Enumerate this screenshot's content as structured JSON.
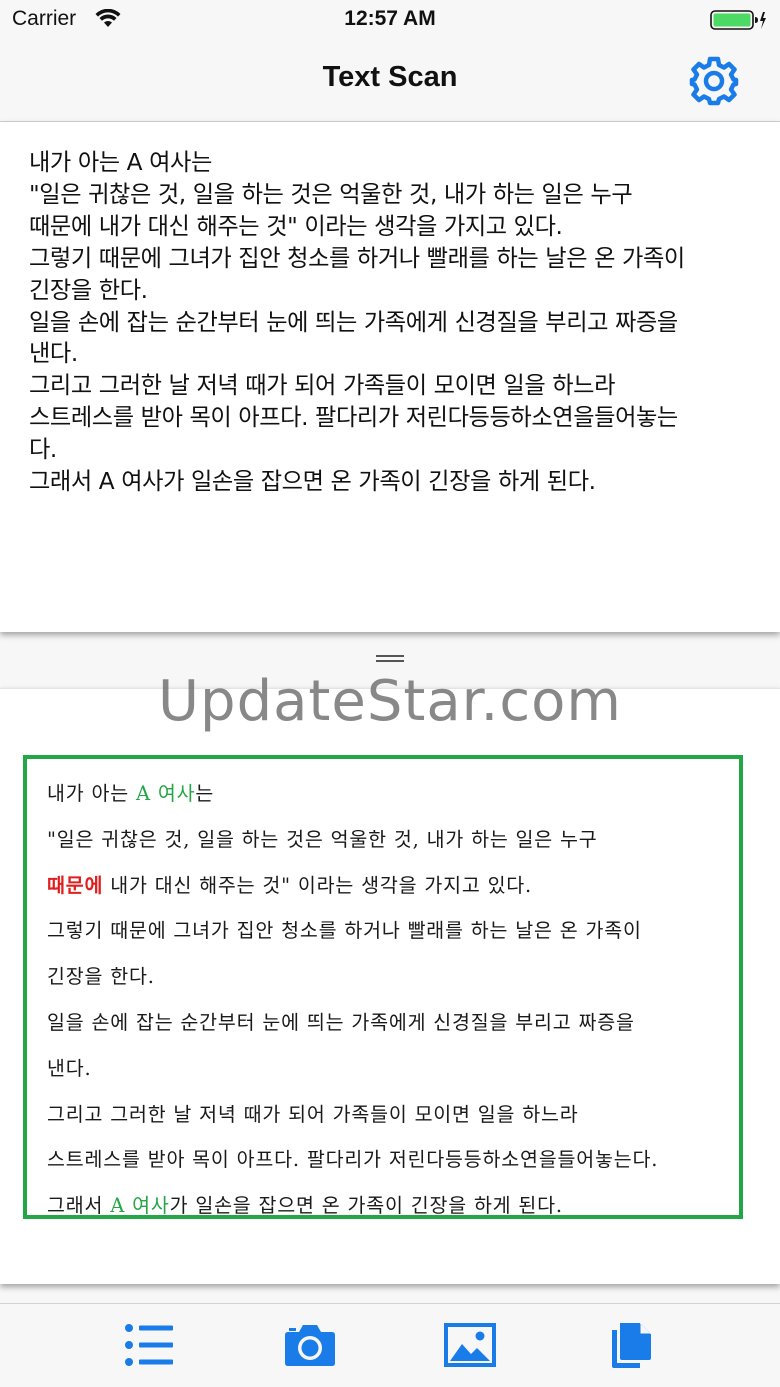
{
  "status_bar": {
    "carrier": "Carrier",
    "time": "12:57 AM"
  },
  "nav": {
    "title": "Text Scan",
    "settings_icon": "gear-icon"
  },
  "result": {
    "lines": [
      "내가 아는 A 여사는",
      "\"일은 귀찮은 것, 일을 하는 것은 억울한 것, 내가 하는 일은 누구",
      "때문에 내가 대신 해주는 것\" 이라는 생각을 가지고 있다.",
      "그렇기 때문에 그녀가 집안 청소를 하거나 빨래를 하는 날은 온 가족이",
      "긴장을 한다.",
      "일을 손에 잡는 순간부터 눈에 띄는 가족에게 신경질을 부리고 짜증을",
      "낸다.",
      "그리고 그러한 날 저녁 때가 되어 가족들이 모이면 일을 하느라",
      "스트레스를 받아 목이 아프다. 팔다리가 저린다등등하소연을들어놓는",
      "다.",
      "그래서 A 여사가 일손을 잡으면 온 가족이 긴장을 하게 된다."
    ]
  },
  "image": {
    "watermark": "UpdateStar.com",
    "line1_pre": "내가 아는 ",
    "line1_hl": "A 여사",
    "line1_post": "는",
    "line2": "\"일은 귀찮은 것, 일을 하는 것은 억울한 것, 내가 하는 일은 누구",
    "line3_hl": "때문에",
    "line3_post": " 내가 대신 해주는 것\" 이라는 생각을 가지고 있다.",
    "line4": "그렇기 때문에 그녀가 집안 청소를 하거나 빨래를 하는 날은 온 가족이",
    "line5": "긴장을 한다.",
    "line6": "일을 손에 잡는 순간부터 눈에 띄는 가족에게 신경질을 부리고 짜증을",
    "line7": "낸다.",
    "line8": "그리고 그러한 날 저녁 때가 되어 가족들이 모이면 일을 하느라",
    "line9": "스트레스를 받아 목이 아프다. 팔다리가 저린다등등하소연을들어놓는다.",
    "line10_pre": "그래서 ",
    "line10_hl": "A 여사",
    "line10_post": "가 일손을 잡으면 온 가족이 긴장을 하게 된다."
  },
  "tabs": [
    {
      "icon": "list-icon"
    },
    {
      "icon": "camera-icon"
    },
    {
      "icon": "photo-icon"
    },
    {
      "icon": "copy-icon"
    }
  ],
  "colors": {
    "accent": "#1a7ce8",
    "frame_green": "#22a646",
    "highlight_red": "#e02020",
    "battery_green": "#4cd964"
  }
}
